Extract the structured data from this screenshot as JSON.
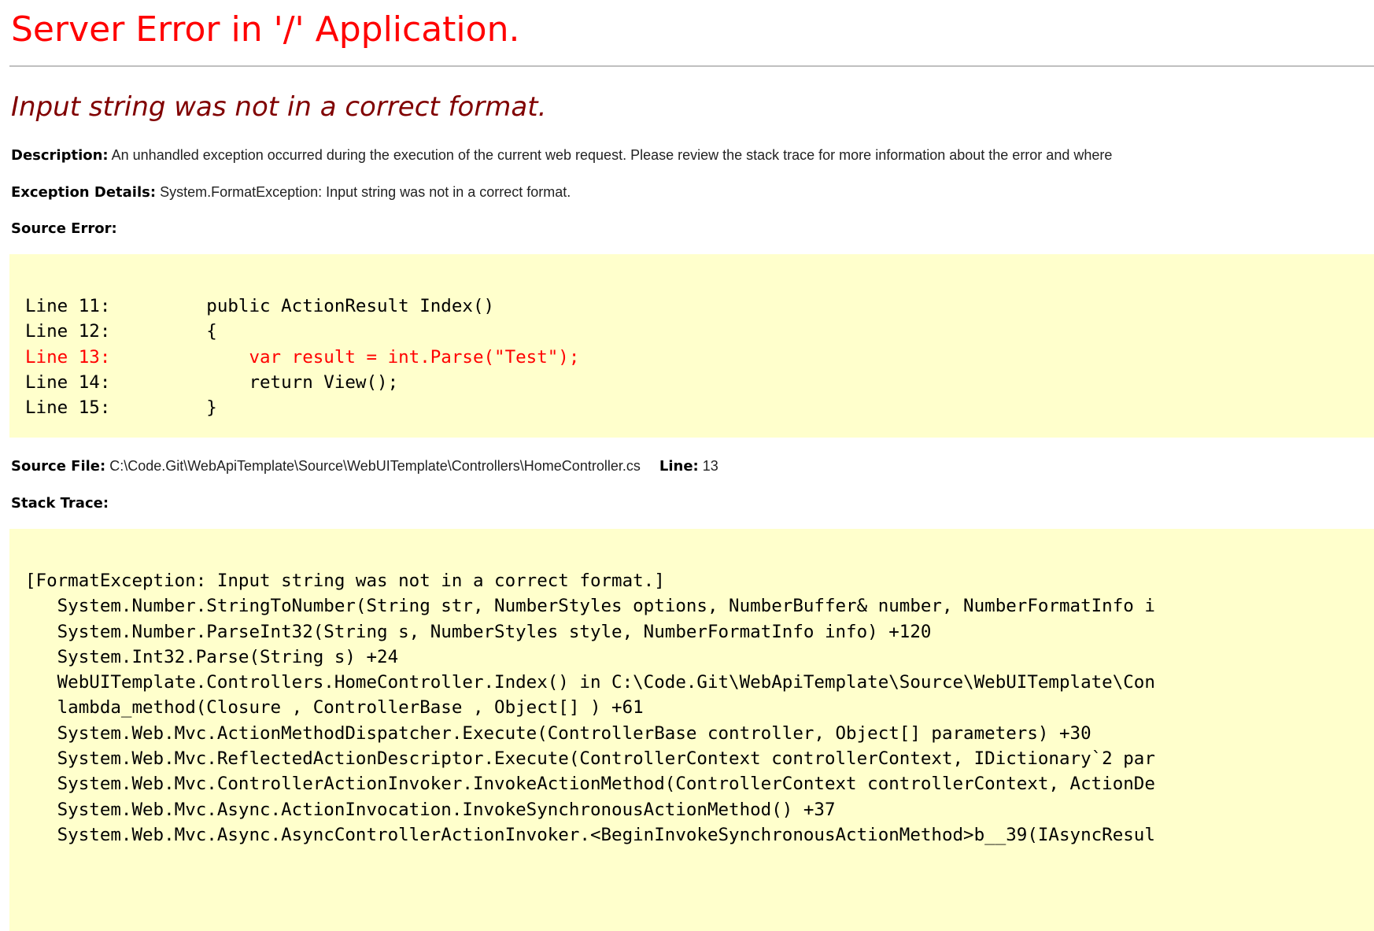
{
  "page": {
    "title": "Server Error in '/' Application.",
    "error_message": "Input string was not in a correct format."
  },
  "description": {
    "label": "Description:",
    "text": "An unhandled exception occurred during the execution of the current web request. Please review the stack trace for more information about the error and where"
  },
  "exception_details": {
    "label": "Exception Details:",
    "text": "System.FormatException: Input string was not in a correct format."
  },
  "source_error": {
    "label": "Source Error:",
    "lines": [
      {
        "text": "Line 11:         public ActionResult Index()",
        "highlight": false
      },
      {
        "text": "Line 12:         {",
        "highlight": false
      },
      {
        "text": "Line 13:             var result = int.Parse(\"Test\");",
        "highlight": true
      },
      {
        "text": "Line 14:             return View();",
        "highlight": false
      },
      {
        "text": "Line 15:         }",
        "highlight": false
      }
    ]
  },
  "source_file": {
    "label": "Source File:",
    "path": "C:\\Code.Git\\WebApiTemplate\\Source\\WebUITemplate\\Controllers\\HomeController.cs",
    "line_label": "Line:",
    "line_number": "13"
  },
  "stack_trace": {
    "label": "Stack Trace:",
    "lines": [
      "[FormatException: Input string was not in a correct format.]",
      "   System.Number.StringToNumber(String str, NumberStyles options, NumberBuffer& number, NumberFormatInfo i",
      "   System.Number.ParseInt32(String s, NumberStyles style, NumberFormatInfo info) +120",
      "   System.Int32.Parse(String s) +24",
      "   WebUITemplate.Controllers.HomeController.Index() in C:\\Code.Git\\WebApiTemplate\\Source\\WebUITemplate\\Con",
      "   lambda_method(Closure , ControllerBase , Object[] ) +61",
      "   System.Web.Mvc.ActionMethodDispatcher.Execute(ControllerBase controller, Object[] parameters) +30",
      "   System.Web.Mvc.ReflectedActionDescriptor.Execute(ControllerContext controllerContext, IDictionary`2 par",
      "   System.Web.Mvc.ControllerActionInvoker.InvokeActionMethod(ControllerContext controllerContext, ActionDe",
      "   System.Web.Mvc.Async.ActionInvocation.InvokeSynchronousActionMethod() +37",
      "   System.Web.Mvc.Async.AsyncControllerActionInvoker.<BeginInvokeSynchronousActionMethod>b__39(IAsyncResul"
    ]
  },
  "colors": {
    "title": "#ff0000",
    "error_message": "#800000",
    "code_background": "#ffffcc",
    "highlight_line": "#ff0000"
  }
}
